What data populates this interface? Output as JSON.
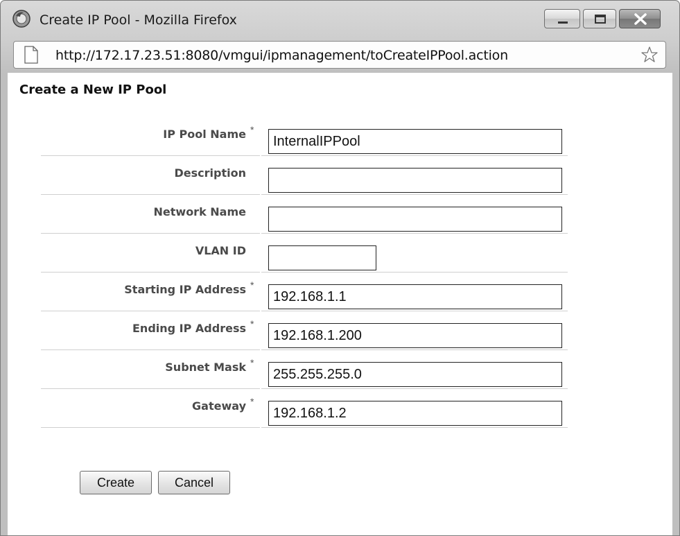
{
  "window": {
    "title": "Create IP Pool - Mozilla Firefox",
    "url": "http://172.17.23.51:8080/vmgui/ipmanagement/toCreateIPPool.action"
  },
  "page": {
    "title": "Create a New IP Pool"
  },
  "form": {
    "required_mark": "*",
    "fields": [
      {
        "label": "IP Pool Name",
        "value": "InternalIPPool",
        "required": true
      },
      {
        "label": "Description",
        "value": "",
        "required": false
      },
      {
        "label": "Network Name",
        "value": "",
        "required": false
      },
      {
        "label": "VLAN ID",
        "value": "",
        "required": false
      },
      {
        "label": "Starting IP Address",
        "value": "192.168.1.1",
        "required": true
      },
      {
        "label": "Ending IP Address",
        "value": "192.168.1.200",
        "required": true
      },
      {
        "label": "Subnet Mask",
        "value": "255.255.255.0",
        "required": true
      },
      {
        "label": "Gateway",
        "value": "192.168.1.2",
        "required": true
      }
    ]
  },
  "buttons": {
    "create": "Create",
    "cancel": "Cancel"
  },
  "icons": {
    "app": "firefox-icon",
    "page": "page-icon",
    "bookmark": "star-icon"
  }
}
